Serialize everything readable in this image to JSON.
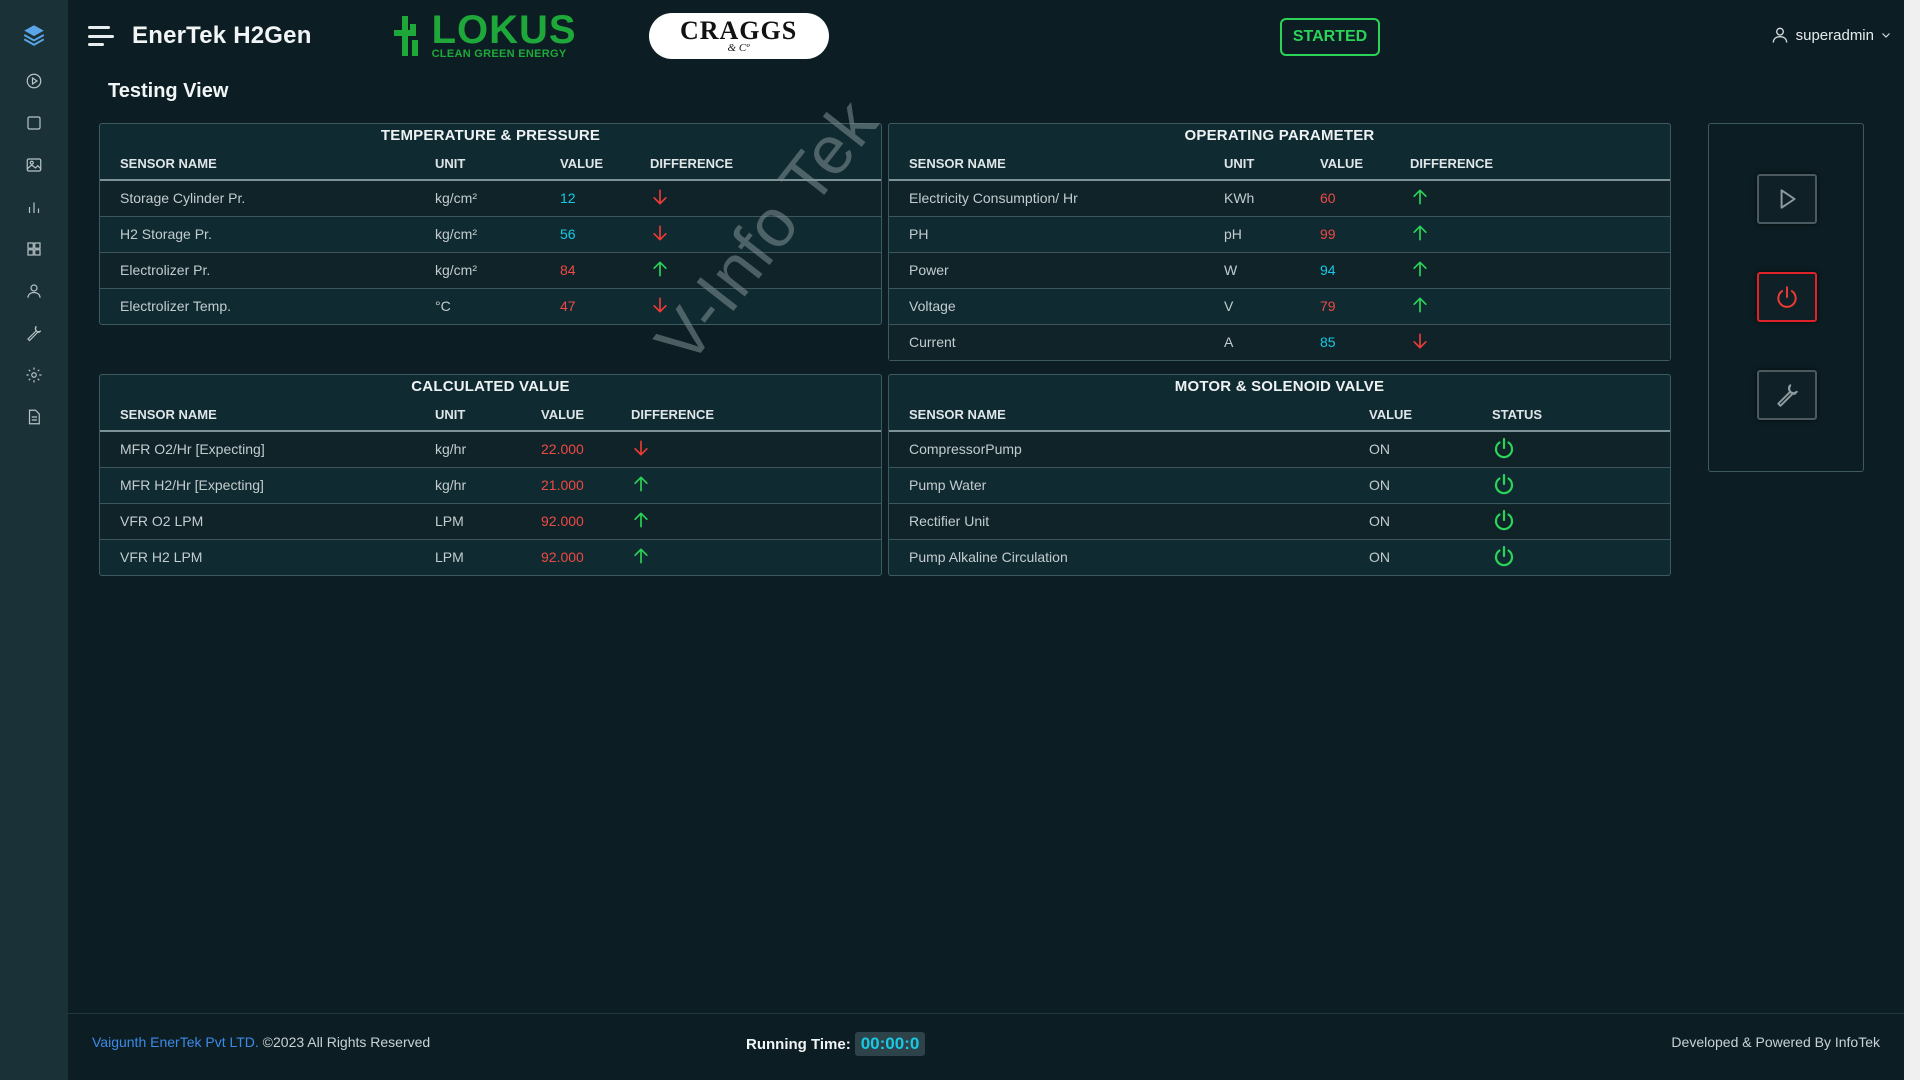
{
  "app": {
    "title": "EnerTek H2Gen"
  },
  "brand": {
    "lokus_name": "LOKUS",
    "lokus_tagline": "CLEAN GREEN ENERGY",
    "craggs_name": "CRAGGS",
    "craggs_sub": "& Cº"
  },
  "header": {
    "status": "STARTED",
    "user": "superadmin"
  },
  "page": {
    "title": "Testing View"
  },
  "sidebar": {
    "icons": [
      "layers-icon",
      "play-circle-icon",
      "square-icon",
      "image-icon",
      "bar-chart-icon",
      "grid-icon",
      "user-icon",
      "wrench-icon",
      "settings-icon",
      "document-icon"
    ]
  },
  "temp_pressure": {
    "title": "TEMPERATURE & PRESSURE",
    "columns": [
      "SENSOR NAME",
      "UNIT",
      "VALUE",
      "DIFFERENCE"
    ],
    "rows": [
      {
        "name": "Storage Cylinder Pr.",
        "unit": "kg/cm²",
        "value": "12",
        "color": "#17c9e3",
        "diff": "down"
      },
      {
        "name": "H2 Storage Pr.",
        "unit": "kg/cm²",
        "value": "56",
        "color": "#17c9e3",
        "diff": "down"
      },
      {
        "name": "Electrolizer Pr.",
        "unit": "kg/cm²",
        "value": "84",
        "color": "#ee4a45",
        "diff": "up"
      },
      {
        "name": "Electrolizer Temp.",
        "unit": "°C",
        "value": "47",
        "color": "#ee4a45",
        "diff": "down"
      }
    ]
  },
  "operating": {
    "title": "OPERATING PARAMETER",
    "columns": [
      "SENSOR NAME",
      "UNIT",
      "VALUE",
      "DIFFERENCE"
    ],
    "rows": [
      {
        "name": "Electricity Consumption/ Hr",
        "unit": "KWh",
        "value": "60",
        "color": "#ee4a45",
        "diff": "up"
      },
      {
        "name": "PH",
        "unit": "pH",
        "value": "99",
        "color": "#ee4a45",
        "diff": "up"
      },
      {
        "name": "Power",
        "unit": "W",
        "value": "94",
        "color": "#17c9e3",
        "diff": "up"
      },
      {
        "name": "Voltage",
        "unit": "V",
        "value": "79",
        "color": "#ee4a45",
        "diff": "up"
      },
      {
        "name": "Current",
        "unit": "A",
        "value": "85",
        "color": "#17c9e3",
        "diff": "down"
      }
    ]
  },
  "calculated": {
    "title": "CALCULATED VALUE",
    "columns": [
      "SENSOR NAME",
      "UNIT",
      "VALUE",
      "DIFFERENCE"
    ],
    "rows": [
      {
        "name": "MFR O2/Hr [Expecting]",
        "unit": "kg/hr",
        "value": "22.000",
        "color": "#ee4a45",
        "diff": "down"
      },
      {
        "name": "MFR H2/Hr [Expecting]",
        "unit": "kg/hr",
        "value": "21.000",
        "color": "#ee4a45",
        "diff": "up"
      },
      {
        "name": "VFR O2 LPM",
        "unit": "LPM",
        "value": "92.000",
        "color": "#ee4a45",
        "diff": "up"
      },
      {
        "name": "VFR H2 LPM",
        "unit": "LPM",
        "value": "92.000",
        "color": "#ee4a45",
        "diff": "up"
      }
    ]
  },
  "motor": {
    "title": "MOTOR & SOLENOID VALVE",
    "columns": [
      "SENSOR NAME",
      "VALUE",
      "STATUS"
    ],
    "rows": [
      {
        "name": "CompressorPump",
        "value": "ON"
      },
      {
        "name": "Pump Water",
        "value": "ON"
      },
      {
        "name": "Rectifier Unit",
        "value": "ON"
      },
      {
        "name": "Pump Alkaline Circulation",
        "value": "ON"
      }
    ]
  },
  "watermark": "V-Info Tek",
  "footer": {
    "company": "Vaigunth EnerTek Pvt LTD.",
    "rights": " ©2023 All Rights Reserved",
    "running_label": "Running Time:",
    "running_time": "00:00:0",
    "powered": "Developed & Powered By InfoTek"
  },
  "colors": {
    "accent_green": "#2bd458",
    "alert_red": "#ee3b35",
    "value_cyan": "#17c9e3",
    "background": "#0c1e24"
  }
}
